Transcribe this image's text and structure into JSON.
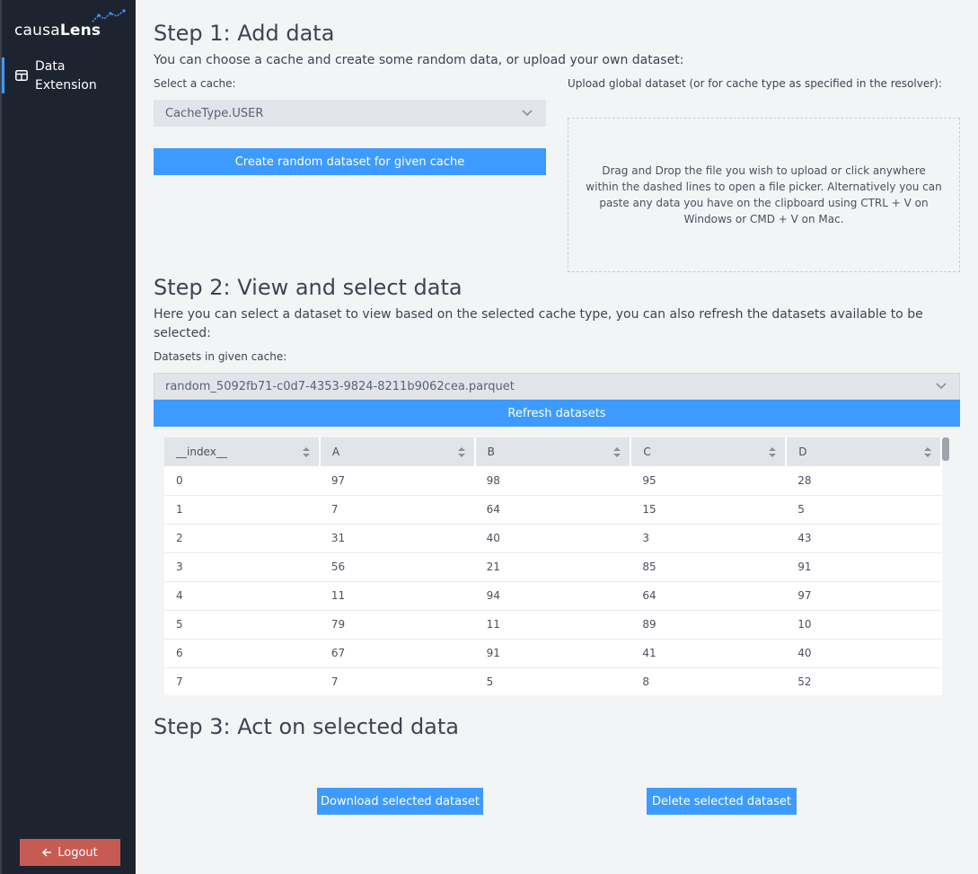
{
  "brand": {
    "name_light": "causa",
    "name_bold": "Lens"
  },
  "sidebar": {
    "nav": [
      {
        "label_line1": "Data",
        "label_line2": "Extension",
        "icon": "table-icon"
      }
    ],
    "logout_label": "Logout",
    "logout_icon": "arrow-left-icon"
  },
  "step1": {
    "title": "Step 1: Add data",
    "description": "You can choose a cache and create some random data, or upload your own dataset:",
    "cache_label": "Select a cache:",
    "cache_value": "CacheType.USER",
    "create_button": "Create random dataset for given cache",
    "upload_label": "Upload global dataset (or for cache type as specified in the resolver):",
    "dropzone_text": "Drag and Drop the file you wish to upload or click anywhere within the dashed lines to open a file picker. Alternatively you can paste any data you have on the clipboard using CTRL + V on Windows or CMD + V on Mac."
  },
  "step2": {
    "title": "Step 2: View and select data",
    "description": "Here you can select a dataset to view based on the selected cache type, you can also refresh the datasets available to be selected:",
    "datasets_label": "Datasets in given cache:",
    "dataset_value": "random_5092fb71-c0d7-4353-9824-8211b9062cea.parquet",
    "refresh_button": "Refresh datasets",
    "table": {
      "columns": [
        "__index__",
        "A",
        "B",
        "C",
        "D"
      ],
      "rows": [
        [
          "0",
          "97",
          "98",
          "95",
          "28"
        ],
        [
          "1",
          "7",
          "64",
          "15",
          "5"
        ],
        [
          "2",
          "31",
          "40",
          "3",
          "43"
        ],
        [
          "3",
          "56",
          "21",
          "85",
          "91"
        ],
        [
          "4",
          "11",
          "94",
          "64",
          "97"
        ],
        [
          "5",
          "79",
          "11",
          "89",
          "10"
        ],
        [
          "6",
          "67",
          "91",
          "41",
          "40"
        ],
        [
          "7",
          "7",
          "5",
          "8",
          "52"
        ]
      ]
    }
  },
  "step3": {
    "title": "Step 3: Act on selected data",
    "download_button": "Download selected dataset",
    "delete_button": "Delete selected dataset"
  },
  "colors": {
    "sidebar": "#1e2330",
    "accent": "#3d9bff",
    "logout": "#c85a54",
    "background": "#f3f4f6"
  }
}
